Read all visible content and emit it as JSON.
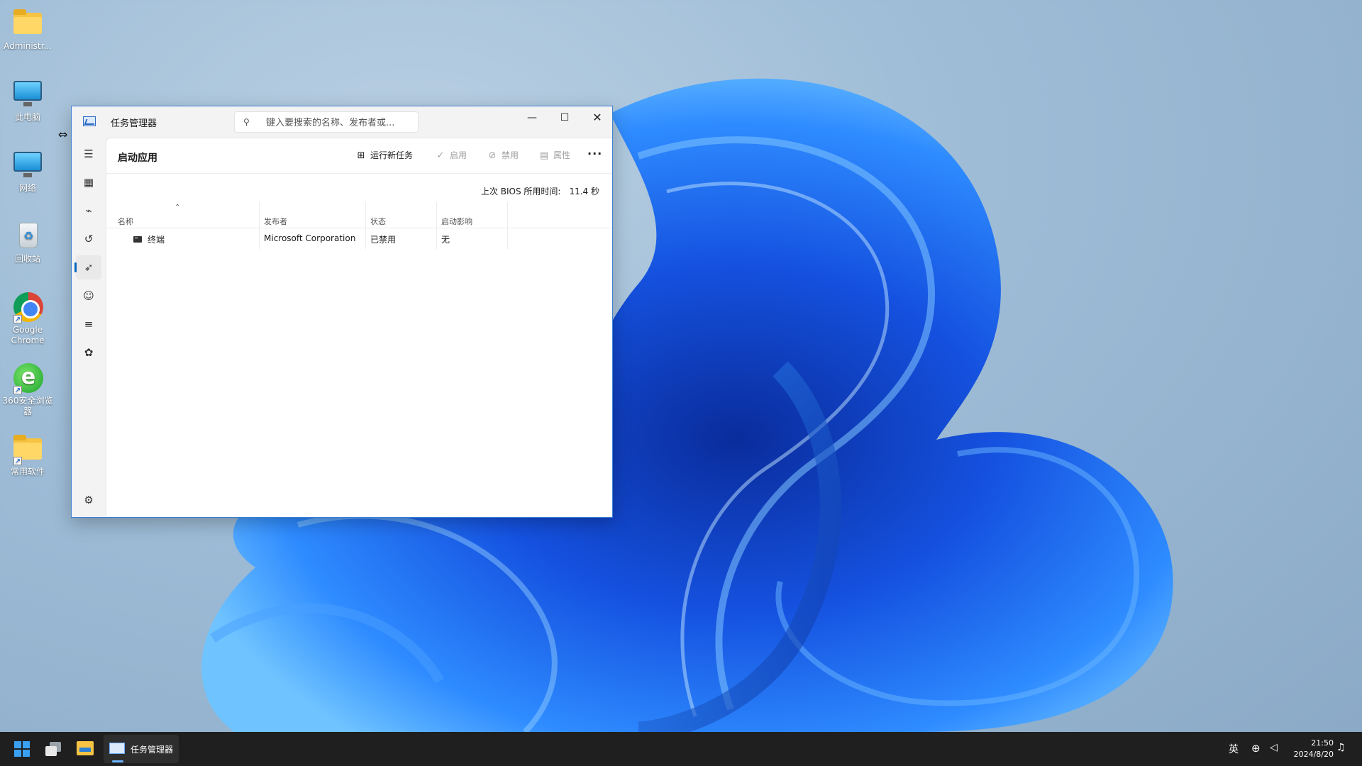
{
  "desktop": {
    "icons": [
      {
        "label": "Administr..."
      },
      {
        "label": "此电脑"
      },
      {
        "label": "网络"
      },
      {
        "label": "回收站"
      },
      {
        "label": "Google Chrome"
      },
      {
        "label": "360安全浏览器"
      },
      {
        "label": "常用软件"
      }
    ]
  },
  "window": {
    "title": "任务管理器",
    "search_placeholder": "键入要搜索的名称、发布者或...",
    "controls": {
      "minimize": "—",
      "maximize": "☐",
      "close": "✕"
    },
    "nav": [
      {
        "icon": "hamburger-icon",
        "glyph": "☰"
      },
      {
        "icon": "processes-icon",
        "glyph": "▦"
      },
      {
        "icon": "performance-icon",
        "glyph": "⌁"
      },
      {
        "icon": "app-history-icon",
        "glyph": "↺"
      },
      {
        "icon": "startup-apps-icon",
        "glyph": "➶"
      },
      {
        "icon": "users-icon",
        "glyph": "☺"
      },
      {
        "icon": "details-icon",
        "glyph": "≡"
      },
      {
        "icon": "services-icon",
        "glyph": "✿"
      },
      {
        "icon": "settings-icon",
        "glyph": "⚙"
      }
    ],
    "page_title": "启动应用",
    "toolbar": {
      "run_new_task": "运行新任务",
      "enable": "启用",
      "disable": "禁用",
      "properties": "属性",
      "more": "···"
    },
    "bios": {
      "label": "上次 BIOS 所用时间:",
      "value": "11.4 秒"
    },
    "columns": [
      "名称",
      "发布者",
      "状态",
      "启动影响"
    ],
    "rows": [
      {
        "name": "终端",
        "publisher": "Microsoft Corporation",
        "status": "已禁用",
        "impact": "无"
      }
    ]
  },
  "taskbar": {
    "app_label": "任务管理器",
    "ime": "英",
    "time": "21:50",
    "date": "2024/8/20"
  }
}
